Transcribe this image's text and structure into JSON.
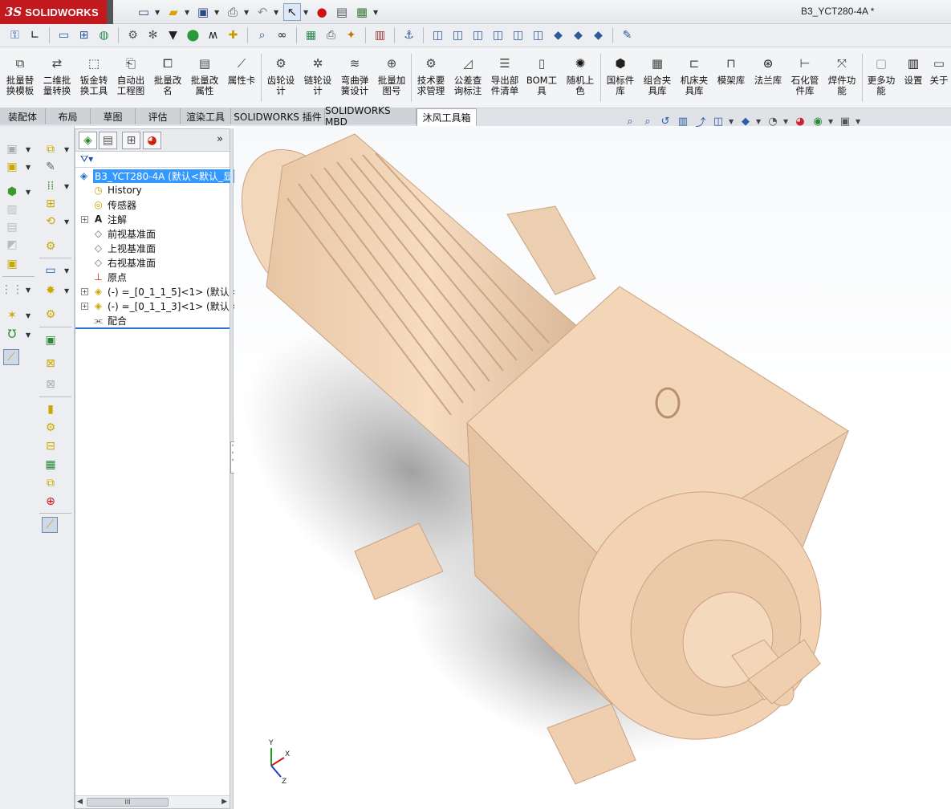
{
  "app": {
    "logo_ds": "3S",
    "logo_name": "SOLIDWORKS",
    "document_title": "B3_YCT280-4A *"
  },
  "quick_access": {
    "icons": [
      "new-document-icon",
      "open-folder-icon",
      "save-icon",
      "print-icon",
      "undo-icon",
      "select-pointer-icon",
      "rebuild-traffic-light-icon",
      "file-properties-icon",
      "options-icon"
    ]
  },
  "ribbon": {
    "buttons": [
      {
        "label": "批量替\n换模板",
        "icon": "batch-replace-template-icon"
      },
      {
        "label": "二维批\n量转换",
        "icon": "2d-batch-convert-icon"
      },
      {
        "label": "钣金转\n换工具",
        "icon": "sheetmetal-convert-icon"
      },
      {
        "label": "自动出\n工程图",
        "icon": "auto-drawing-icon"
      },
      {
        "label": "批量改\n名",
        "icon": "batch-rename-icon"
      },
      {
        "label": "批量改\n属性",
        "icon": "batch-properties-icon"
      },
      {
        "label": "属性卡",
        "icon": "property-card-icon"
      },
      {
        "label": "齿轮设\n计",
        "icon": "gear-design-icon"
      },
      {
        "label": "链轮设\n计",
        "icon": "sprocket-design-icon"
      },
      {
        "label": "弯曲弹\n簧设计",
        "icon": "spring-design-icon"
      },
      {
        "label": "批量加\n图号",
        "icon": "batch-drawing-number-icon"
      },
      {
        "label": "技术要\n求管理",
        "icon": "tech-requirements-icon"
      },
      {
        "label": "公差查\n询标注",
        "icon": "tolerance-query-icon"
      },
      {
        "label": "导出部\n件清单",
        "icon": "export-parts-list-icon"
      },
      {
        "label": "BOM工\n具",
        "icon": "bom-tool-icon"
      },
      {
        "label": "随机上\n色",
        "icon": "random-color-icon"
      },
      {
        "label": "国标件\n库",
        "icon": "standard-parts-library-icon"
      },
      {
        "label": "组合夹\n具库",
        "icon": "modular-fixture-library-icon"
      },
      {
        "label": "机床夹\n具库",
        "icon": "machine-fixture-library-icon"
      },
      {
        "label": "模架库",
        "icon": "mold-base-library-icon"
      },
      {
        "label": "法兰库",
        "icon": "flange-library-icon"
      },
      {
        "label": "石化管\n件库",
        "icon": "pipe-fitting-library-icon"
      },
      {
        "label": "焊件功\n能",
        "icon": "weldment-icon"
      },
      {
        "label": "更多功\n能",
        "icon": "more-functions-icon"
      },
      {
        "label": "设置",
        "icon": "settings-icon"
      },
      {
        "label": "关于",
        "icon": "about-icon"
      }
    ]
  },
  "tabs": [
    {
      "label": "装配体",
      "active": false
    },
    {
      "label": "布局",
      "active": false
    },
    {
      "label": "草图",
      "active": false
    },
    {
      "label": "评估",
      "active": false
    },
    {
      "label": "渲染工具",
      "active": false
    },
    {
      "label": "SOLIDWORKS 插件",
      "active": false
    },
    {
      "label": "SOLIDWORKS MBD",
      "active": false
    },
    {
      "label": "沐风工具箱",
      "active": true
    }
  ],
  "feature_manager": {
    "more": "»",
    "tree": [
      {
        "label": "B3_YCT280-4A  (默认<默认_显",
        "icon": "assembly-icon",
        "selected": true
      },
      {
        "label": "History",
        "icon": "history-icon"
      },
      {
        "label": "传感器",
        "icon": "sensor-icon"
      },
      {
        "label": "注解",
        "icon": "annotation-icon",
        "expandable": true
      },
      {
        "label": "前视基准面",
        "icon": "plane-icon"
      },
      {
        "label": "上视基准面",
        "icon": "plane-icon"
      },
      {
        "label": "右视基准面",
        "icon": "plane-icon"
      },
      {
        "label": "原点",
        "icon": "origin-icon"
      },
      {
        "label": "(-) =_[0_1_1_5]<1> (默认<",
        "icon": "subassembly-icon",
        "expandable": true
      },
      {
        "label": "(-) =_[0_1_1_3]<1> (默认<",
        "icon": "subassembly-icon",
        "expandable": true
      },
      {
        "label": "配合",
        "icon": "mates-icon"
      }
    ],
    "scroll_thumb": "III"
  },
  "triad": {
    "x": "X",
    "y": "Y",
    "z": "Z"
  },
  "colors": {
    "model": "#f2d3b4",
    "model_shadow": "#d9b596",
    "logo_red": "#c2191f",
    "selection": "#3399ff"
  }
}
